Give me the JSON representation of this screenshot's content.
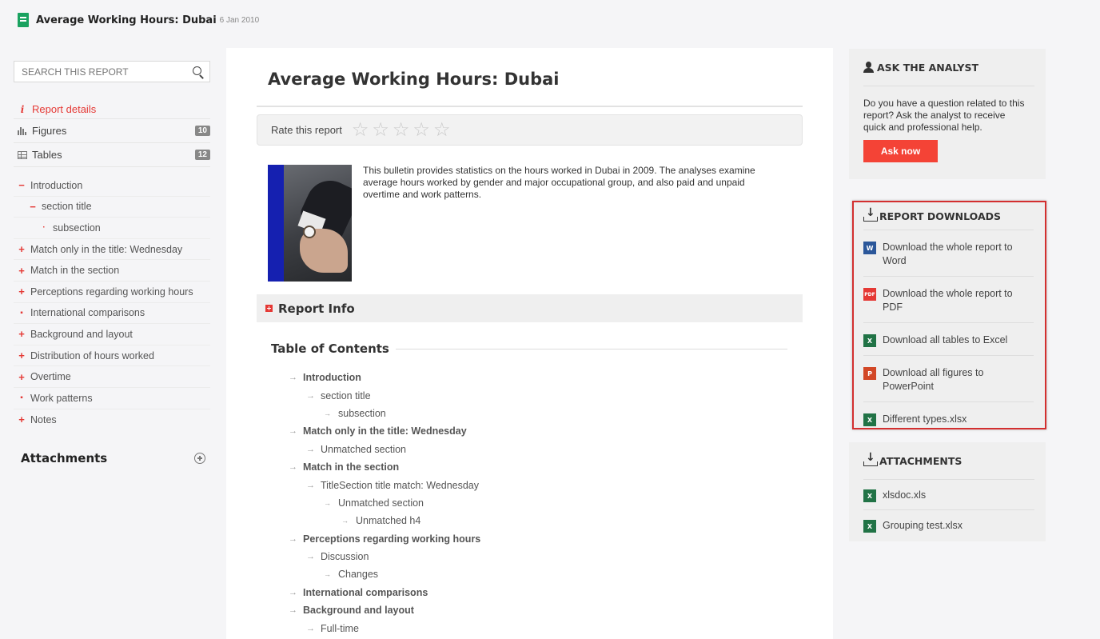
{
  "header": {
    "title": "Average Working Hours: Dubai",
    "date": "6 Jan 2010"
  },
  "sidebar": {
    "search_placeholder": "SEARCH THIS REPORT",
    "report_details": "Report details",
    "figures_label": "Figures",
    "figures_count": "10",
    "tables_label": "Tables",
    "tables_count": "12",
    "toc": [
      {
        "label": "Introduction",
        "marker": "−"
      },
      {
        "label": "section title",
        "marker": "−"
      },
      {
        "label": "subsection",
        "marker": "·"
      },
      {
        "label": "Match only in the title: Wednesday",
        "marker": "+"
      },
      {
        "label": "Match in the section",
        "marker": "+"
      },
      {
        "label": "Perceptions regarding working hours",
        "marker": "+"
      },
      {
        "label": "International comparisons",
        "marker": "▪"
      },
      {
        "label": "Background and layout",
        "marker": "+"
      },
      {
        "label": "Distribution of hours worked",
        "marker": "+"
      },
      {
        "label": "Overtime",
        "marker": "+"
      },
      {
        "label": "Work patterns",
        "marker": "▪"
      },
      {
        "label": "Notes",
        "marker": "+"
      }
    ],
    "attachments_title": "Attachments"
  },
  "main": {
    "title": "Average Working Hours: Dubai",
    "rate_label": "Rate this report",
    "rating": 0,
    "rating_max": 5,
    "intro": "This bulletin provides statistics on the hours worked in Dubai in 2009. The analyses examine average hours worked by gender and major occupational group, and also paid and unpaid overtime and work patterns.",
    "report_info": "Report Info",
    "toc_title": "Table of Contents",
    "toc": [
      {
        "label": "Introduction",
        "depth": 1,
        "bold": true
      },
      {
        "label": "section title",
        "depth": 2,
        "bold": false
      },
      {
        "label": "subsection",
        "depth": 3,
        "bold": false
      },
      {
        "label": "Match only in the title: Wednesday",
        "depth": 1,
        "bold": true
      },
      {
        "label": "Unmatched section",
        "depth": 2,
        "bold": false
      },
      {
        "label": "Match in the section",
        "depth": 1,
        "bold": true
      },
      {
        "label": "TitleSection title match: Wednesday",
        "depth": 2,
        "bold": false
      },
      {
        "label": "Unmatched section",
        "depth": 3,
        "bold": false
      },
      {
        "label": "Unmatched h4",
        "depth": 4,
        "bold": false
      },
      {
        "label": "Perceptions regarding working hours",
        "depth": 1,
        "bold": true
      },
      {
        "label": "Discussion",
        "depth": 2,
        "bold": false
      },
      {
        "label": "Changes",
        "depth": 3,
        "bold": false
      },
      {
        "label": "International comparisons",
        "depth": 1,
        "bold": true
      },
      {
        "label": "Background and layout",
        "depth": 1,
        "bold": true
      },
      {
        "label": "Full-time",
        "depth": 2,
        "bold": false
      }
    ]
  },
  "ask": {
    "title": "ASK THE ANALYST",
    "text": "Do you have a question related to this report? Ask the analyst to receive quick and professional help.",
    "button": "Ask now"
  },
  "downloads": {
    "title": "REPORT DOWNLOADS",
    "items": [
      {
        "label": "Download the whole report to Word",
        "icon": "word-icon",
        "badge": "W"
      },
      {
        "label": "Download the whole report to PDF",
        "icon": "pdf-icon",
        "badge": "PDF"
      },
      {
        "label": "Download all tables to Excel",
        "icon": "excel-icon",
        "badge": "X"
      },
      {
        "label": "Download all figures to PowerPoint",
        "icon": "powerpoint-icon",
        "badge": "P"
      },
      {
        "label": "Different types.xlsx",
        "icon": "excel-icon",
        "badge": "X"
      }
    ]
  },
  "attachments": {
    "title": "ATTACHMENTS",
    "items": [
      {
        "label": "xlsdoc.xls",
        "icon": "excel-icon",
        "badge": "X"
      },
      {
        "label": "Grouping test.xlsx",
        "icon": "excel-icon",
        "badge": "X"
      }
    ]
  },
  "colors": {
    "accent_red": "#e53935",
    "highlight_border": "#d32f2f",
    "word": "#2b579a",
    "excel": "#217346",
    "powerpoint": "#d24726",
    "pdf": "#e53935"
  }
}
